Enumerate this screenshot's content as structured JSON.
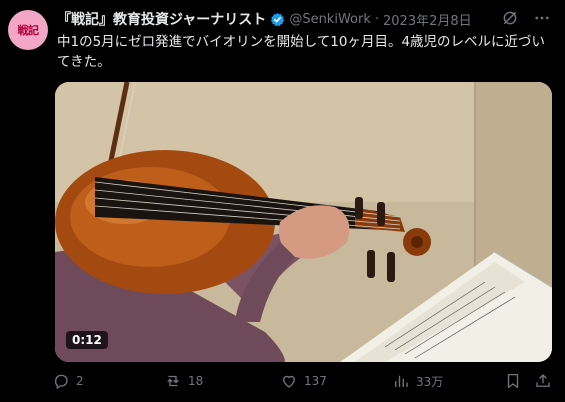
{
  "author": {
    "avatar_text": "戦記",
    "display_name": "『戦記』教育投資ジャーナリスト",
    "handle": "@SenkiWork",
    "separator": "·",
    "date": "2023年2月8日"
  },
  "tweet": {
    "text": "中1の5月にゼロ発進でバイオリンを開始して10ヶ月目。4歳児のレベルに近づいてきた。"
  },
  "media": {
    "duration": "0:12"
  },
  "actions": {
    "replies": "2",
    "reposts": "18",
    "likes": "137",
    "views": "33万"
  },
  "icons": {
    "verified": "verified-badge-icon",
    "grok": "grok-icon",
    "more": "more-icon",
    "reply": "reply-icon",
    "repost": "repost-icon",
    "like": "heart-icon",
    "views": "views-icon",
    "bookmark": "bookmark-icon",
    "share": "share-icon"
  },
  "colors": {
    "background": "#000000",
    "text_primary": "#e7e9ea",
    "text_secondary": "#71767b",
    "verified_blue": "#1d9bf0",
    "avatar_bg": "#f4a6c7"
  }
}
